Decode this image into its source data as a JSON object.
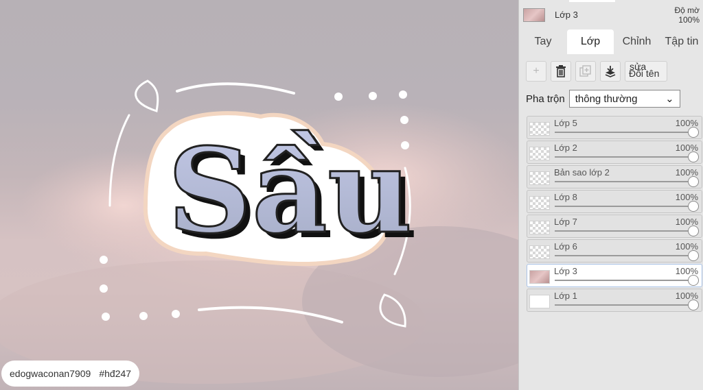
{
  "canvas": {
    "artwork_title": "Sầu",
    "credit_user": "edogwaconan7909",
    "credit_tag": "#hđ247"
  },
  "panel": {
    "current_layer_name": "Lớp 3",
    "opacity_label": "Độ mờ",
    "opacity_value": "100%",
    "tabs": [
      {
        "label": "Tay",
        "active": false
      },
      {
        "label": "Lớp",
        "active": true
      },
      {
        "label": "Chỉnh",
        "active": false
      },
      {
        "label": "Tập tin",
        "active": false
      }
    ],
    "toolbar": {
      "add_icon": "+",
      "delete_icon": "trash-icon",
      "duplicate_icon": "duplicate-icon",
      "merge_icon": "merge-down-icon",
      "rename_label_1": "sửa",
      "rename_label_2": "Đổi tên"
    },
    "blend": {
      "label": "Pha trộn",
      "value": "thông thường"
    },
    "layers": [
      {
        "name": "Lớp 5",
        "opacity": "100%"
      },
      {
        "name": "Lớp 2",
        "opacity": "100%"
      },
      {
        "name": "Bản sao lớp 2",
        "opacity": "100%"
      },
      {
        "name": "Lớp 8",
        "opacity": "100%"
      },
      {
        "name": "Lớp 7",
        "opacity": "100%"
      },
      {
        "name": "Lớp 6",
        "opacity": "100%"
      },
      {
        "name": "Lớp 3",
        "opacity": "100%"
      },
      {
        "name": "Lớp 1",
        "opacity": "100%"
      }
    ]
  }
}
